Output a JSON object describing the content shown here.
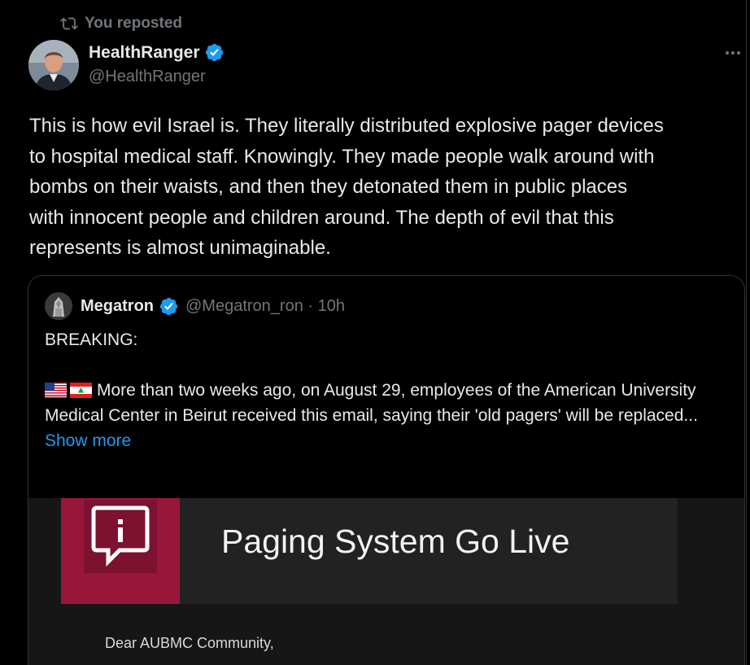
{
  "repost": {
    "label": "You reposted"
  },
  "author": {
    "name": "HealthRanger",
    "handle": "@HealthRanger"
  },
  "tweet": {
    "text": "This is how evil Israel is. They literally distributed explosive pager devices\nto hospital medical staff. Knowingly. They made people walk around with\nbombs on their waists, and then they detonated them in public places\nwith innocent people and children around. The depth of evil that this\nrepresents is almost unimaginable."
  },
  "quote": {
    "name": "Megatron",
    "handle_time": "@Megatron_ron · 10h",
    "line1": "BREAKING:",
    "body": "More than two weeks ago, on August 29, employees of the American University Medical Center in Beirut received this email, saying their 'old pagers' will be replaced...",
    "show_more": "Show more",
    "media": {
      "title": "Paging System Go Live",
      "greeting": "Dear AUBMC Community,"
    }
  },
  "colors": {
    "background": "#000000",
    "text": "#e7e9ea",
    "secondary": "#71767b",
    "accent": "#1d9bf0",
    "border": "#2f3336",
    "aubmc_red": "#99163b"
  },
  "icons": [
    "repost-icon",
    "verified-badge-icon",
    "more-icon",
    "us-flag-icon",
    "lebanon-flag-icon",
    "info-bubble-icon"
  ]
}
